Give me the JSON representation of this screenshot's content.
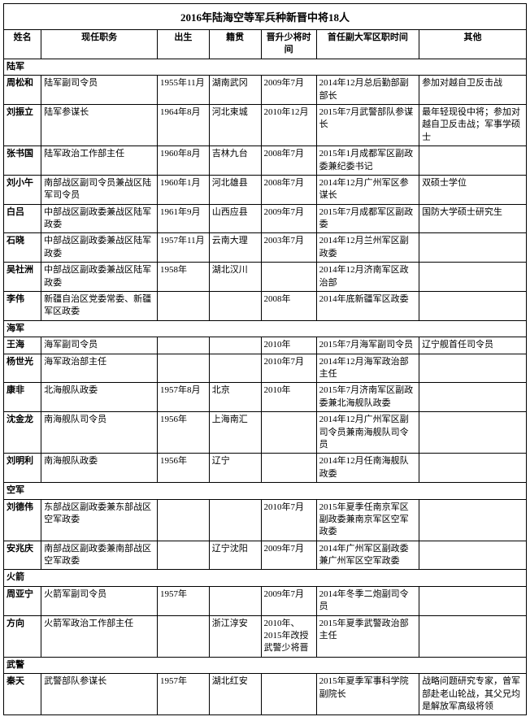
{
  "title": "2016年陆海空等军兵种新晋中将18人",
  "headers": [
    "姓名",
    "现任职务",
    "出生",
    "籍贯",
    "晋升少将时间",
    "首任副大军区职时间",
    "其他"
  ],
  "sections": [
    {
      "section_name": "陆军",
      "rows": [
        {
          "name": "周松和",
          "job": "陆军副司令员",
          "birth": "1955年11月",
          "籍贯": "湖南武冈",
          "promote": "2009年7月",
          "first": "2014年12月总后勤部副部长",
          "other": "参加对越自卫反击战"
        },
        {
          "name": "刘振立",
          "job": "陆军参谋长",
          "birth": "1964年8月",
          "籍贯": "河北束城",
          "promote": "2010年12月",
          "first": "2015年7月武警部队参谋长",
          "other": "最年轻现役中将；参加对越自卫反击战；军事学硕士"
        },
        {
          "name": "张书国",
          "job": "陆军政治工作部主任",
          "birth": "1960年8月",
          "籍贯": "吉林九台",
          "promote": "2008年7月",
          "first": "2015年1月成都军区副政委兼纪委书记",
          "other": ""
        },
        {
          "name": "刘小午",
          "job": "南部战区副司令员兼战区陆军司令员",
          "birth": "1960年1月",
          "籍贯": "河北雄县",
          "promote": "2008年7月",
          "first": "2014年12月广州军区参谋长",
          "other": "双硕士学位"
        },
        {
          "name": "白吕",
          "job": "中部战区副政委兼战区陆军政委",
          "birth": "1961年9月",
          "籍贯": "山西应县",
          "promote": "2009年7月",
          "first": "2015年7月成都军区副政委",
          "other": "国防大学硕士研究生"
        },
        {
          "name": "石晓",
          "job": "中部战区副政委兼战区陆军政委",
          "birth": "1957年11月",
          "籍贯": "云南大理",
          "promote": "2003年7月",
          "first": "2014年12月兰州军区副政委",
          "other": ""
        },
        {
          "name": "吴社洲",
          "job": "中部战区副政委兼战区陆军政委",
          "birth": "1958年",
          "籍贯": "湖北汉川",
          "promote": "",
          "first": "2014年12月济南军区政治部",
          "other": ""
        },
        {
          "name": "李伟",
          "job": "新疆自治区党委常委、新疆军区政委",
          "birth": "",
          "籍贯": "",
          "promote": "2008年",
          "first": "2014年底新疆军区政委",
          "other": ""
        }
      ]
    },
    {
      "section_name": "海军",
      "rows": [
        {
          "name": "王海",
          "job": "海军副司令员",
          "birth": "",
          "籍贯": "",
          "promote": "2010年",
          "first": "2015年7月海军副司令员",
          "other": "辽宁舰首任司令员"
        },
        {
          "name": "杨世光",
          "job": "海军政治部主任",
          "birth": "",
          "籍贯": "",
          "promote": "2010年7月",
          "first": "2014年12月海军政治部主任",
          "other": ""
        },
        {
          "name": "康非",
          "job": "北海舰队政委",
          "birth": "1957年8月",
          "籍贯": "北京",
          "promote": "2010年",
          "first": "2015年7月济南军区副政委兼北海舰队政委",
          "other": ""
        },
        {
          "name": "沈金龙",
          "job": "南海舰队司令员",
          "birth": "1956年",
          "籍贯": "上海南汇",
          "promote": "",
          "first": "2014年12月广州军区副司令员兼南海舰队司令员",
          "other": ""
        },
        {
          "name": "刘明利",
          "job": "南海舰队政委",
          "birth": "1956年",
          "籍贯": "辽宁",
          "promote": "",
          "first": "2014年12月任南海舰队政委",
          "other": ""
        }
      ]
    },
    {
      "section_name": "空军",
      "rows": [
        {
          "name": "刘德伟",
          "job": "东部战区副政委兼东部战区空军政委",
          "birth": "",
          "籍贯": "",
          "promote": "2010年7月",
          "first": "2015年夏季任南京军区副政委兼南京军区空军政委",
          "other": ""
        },
        {
          "name": "安兆庆",
          "job": "南部战区副政委兼南部战区空军政委",
          "birth": "",
          "籍贯": "辽宁沈阳",
          "promote": "2009年7月",
          "first": "2014年广州军区副政委兼广州军区空军政委",
          "other": ""
        }
      ]
    },
    {
      "section_name": "火箭",
      "rows": [
        {
          "name": "周亚宁",
          "job": "火箭军副司令员",
          "birth": "1957年",
          "籍贯": "",
          "promote": "2009年7月",
          "first": "2014年冬季二炮副司令员",
          "other": ""
        },
        {
          "name": "方向",
          "job": "火箭军政治工作部主任",
          "birth": "",
          "籍贯": "浙江淳安",
          "promote": "2010年、2015年改授武警少将晋",
          "first": "2015年夏季武警政治部主任",
          "other": ""
        }
      ]
    },
    {
      "section_name": "武警",
      "rows": [
        {
          "name": "秦天",
          "job": "武警部队参谋长",
          "birth": "1957年",
          "籍贯": "湖北红安",
          "promote": "",
          "first": "2015年夏季军事科学院副院长",
          "other": "战略问题研究专家，曾军部赴老山轮战，其父兄均是解放军高级将领"
        }
      ]
    }
  ]
}
